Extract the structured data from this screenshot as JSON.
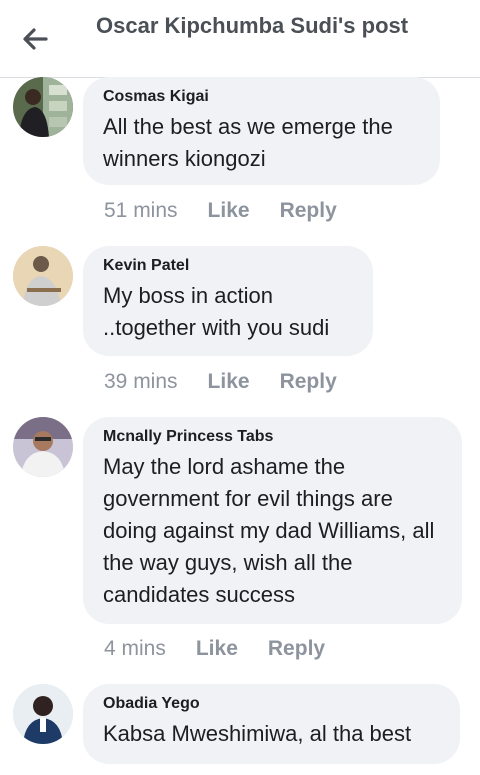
{
  "header": {
    "title": "Oscar Kipchumba Sudi's post",
    "back_icon": "arrow-left-icon"
  },
  "comments": [
    {
      "author": "Cosmas Kigai",
      "text": "All the best as we emerge the winners kiongozi",
      "time": "51 mins",
      "like": "Like",
      "reply": "Reply"
    },
    {
      "author": "Kevin Patel",
      "text": "My boss in action ..together with you sudi",
      "time": "39 mins",
      "like": "Like",
      "reply": "Reply"
    },
    {
      "author": "Mcnally Princess Tabs",
      "text": "May the lord ashame the government for evil things are doing against my dad Williams, all the way guys, wish all the candidates success",
      "time": "4 mins",
      "like": "Like",
      "reply": "Reply"
    },
    {
      "author": "Obadia Yego",
      "text": "Kabsa Mweshimiwa, al tha best",
      "time": "",
      "like": "",
      "reply": ""
    }
  ],
  "colors": {
    "bubble": "#f0f2f5",
    "meta": "#8d949e",
    "title": "#4b4f56"
  }
}
